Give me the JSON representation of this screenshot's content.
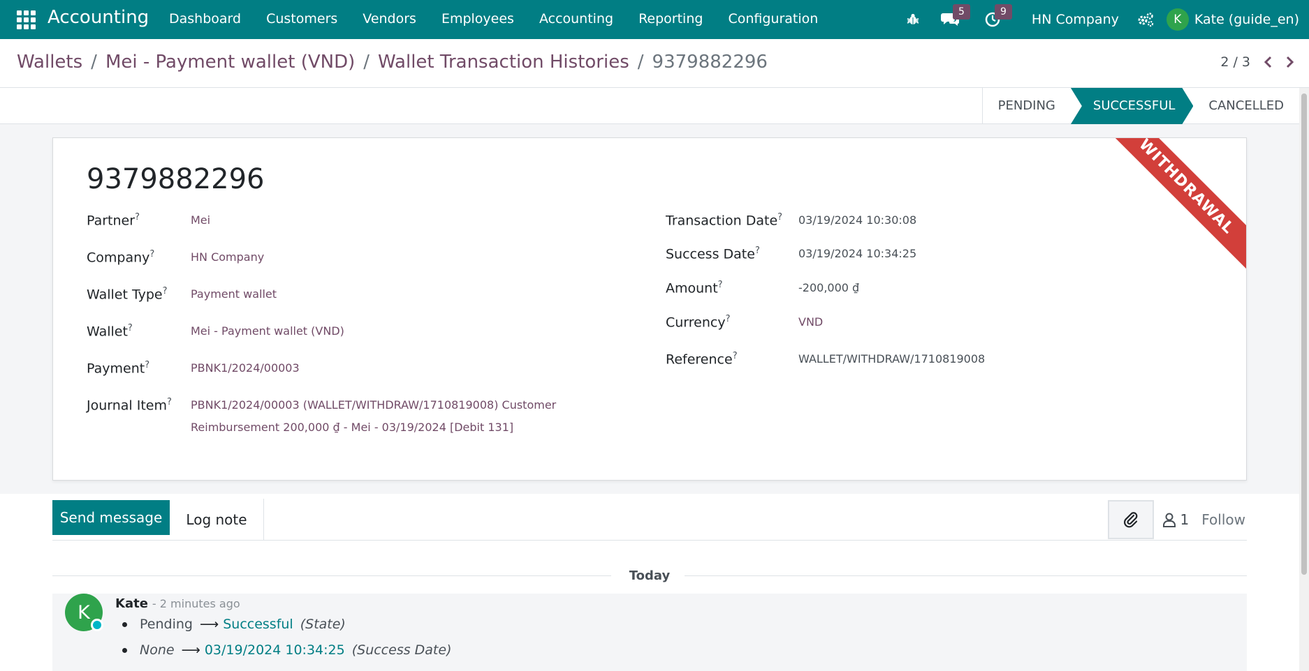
{
  "navbar": {
    "brand": "Accounting",
    "menu": [
      "Dashboard",
      "Customers",
      "Vendors",
      "Employees",
      "Accounting",
      "Reporting",
      "Configuration"
    ],
    "messages_count": "5",
    "activities_count": "9",
    "company": "HN Company",
    "user_initial": "K",
    "user_name": "Kate (guide_en)"
  },
  "breadcrumb": {
    "items": [
      "Wallets",
      "Mei - Payment wallet (VND)",
      "Wallet Transaction Histories"
    ],
    "current": "9379882296",
    "separator": "/"
  },
  "pager": {
    "value": "2 / 3"
  },
  "status": {
    "stages": [
      "PENDING",
      "SUCCESSFUL",
      "CANCELLED"
    ],
    "active": "SUCCESSFUL"
  },
  "record": {
    "ribbon": "WITHDRAWAL",
    "name": "9379882296",
    "left_fields": [
      {
        "label": "Partner",
        "value": "Mei"
      },
      {
        "label": "Company",
        "value": "HN Company"
      },
      {
        "label": "Wallet Type",
        "value": "Payment wallet"
      },
      {
        "label": "Wallet",
        "value": "Mei - Payment wallet (VND)"
      },
      {
        "label": "Payment",
        "value": "PBNK1/2024/00003"
      },
      {
        "label": "Journal Item",
        "value_line1": "PBNK1/2024/00003 (WALLET/WITHDRAW/1710819008) Customer",
        "value_line2": "Reimbursement 200,000 ₫ - Mei - 03/19/2024 [Debit 131]"
      }
    ],
    "right_fields": [
      {
        "label": "Transaction Date",
        "value": "03/19/2024 10:30:08"
      },
      {
        "label": "Success Date",
        "value": "03/19/2024 10:34:25"
      },
      {
        "label": "Amount",
        "value": "-200,000 ₫"
      },
      {
        "label": "Currency",
        "value": "VND"
      },
      {
        "label": "Reference",
        "value": "WALLET/WITHDRAW/1710819008"
      }
    ],
    "help_mark": "?"
  },
  "chatter": {
    "send_label": "Send message",
    "log_label": "Log note",
    "followers_count": "1",
    "follow_label": "Follow",
    "today_label": "Today",
    "message": {
      "author_initial": "K",
      "author": "Kate",
      "time": "- 2 minutes ago",
      "changes": [
        {
          "old": "Pending",
          "new": "Successful",
          "field": "(State)"
        },
        {
          "old": "None",
          "new": "03/19/2024 10:34:25",
          "field": "(Success Date)"
        }
      ]
    }
  },
  "colors": {
    "primary": "#017e84",
    "link": "#714b67",
    "ribbon": "#d23f3a",
    "avatar": "#2fa34c"
  }
}
